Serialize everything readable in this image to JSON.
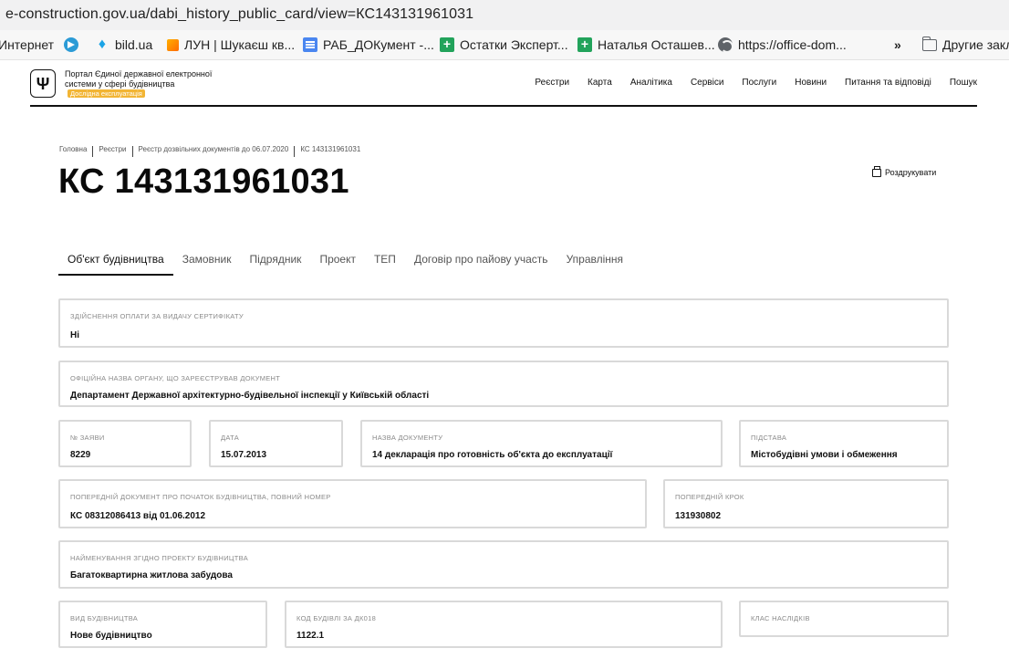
{
  "browser": {
    "url": "e-construction.gov.ua/dabi_history_public_card/view=КС143131961031",
    "bookmarks": [
      {
        "label": "Интернет",
        "icon": "none"
      },
      {
        "label": "",
        "icon": "telegram-icon"
      },
      {
        "label": "bild.ua",
        "icon": "bild-icon"
      },
      {
        "label": "ЛУН | Шукаєш кв...",
        "icon": "lun-icon"
      },
      {
        "label": "РАБ_ДОКумент -...",
        "icon": "docs-icon"
      },
      {
        "label": "Остатки Эксперт...",
        "icon": "sheets-icon"
      },
      {
        "label": "Наталья Осташев...",
        "icon": "sheets-icon"
      },
      {
        "label": "https://office-dom...",
        "icon": "globe-icon"
      }
    ],
    "overflow": "»",
    "other_bookmarks": "Другие закл"
  },
  "header": {
    "portal_name": "Портал Єдиної державної електронної системи у сфері будівництва",
    "beta_badge": "Дослідна експлуатація",
    "nav": [
      "Реєстри",
      "Карта",
      "Аналітика",
      "Сервіси",
      "Послуги",
      "Новини",
      "Питання та відповіді",
      "Пошук"
    ]
  },
  "breadcrumb": [
    "Головна",
    "Реєстри",
    "Реєстр дозвільних документів до 06.07.2020",
    "КС 143131961031"
  ],
  "page": {
    "title": "КС 143131961031",
    "print_label": "Роздрукувати"
  },
  "tabs": [
    "Об'єкт будівництва",
    "Замовник",
    "Підрядник",
    "Проект",
    "ТЕП",
    "Договір про пайову участь",
    "Управління"
  ],
  "fields": {
    "payment": {
      "label": "Здійснення оплати за видачу сертифікату",
      "value": "Ні"
    },
    "authority": {
      "label": "Офіційна назва органу, що зареєстрував документ",
      "value": "Департамент Державної архітектурно-будівельної інспекції у Київській області"
    },
    "app_no": {
      "label": "№ заяви",
      "value": "8229"
    },
    "date": {
      "label": "Дата",
      "value": "15.07.2013"
    },
    "doc_name": {
      "label": "Назва документу",
      "value": "14 декларація про готовність об'єкта до експлуатації"
    },
    "basis": {
      "label": "Підстава",
      "value": "Містобудівні умови і обмеження"
    },
    "prev_doc": {
      "label": "Попередній документ про початок будівництва, повний номер",
      "value": "КС 08312086413 від 01.06.2012"
    },
    "prev_step": {
      "label": "Попередній крок",
      "value": "131930802"
    },
    "project_name": {
      "label": "Найменування згідно проекту будівництва",
      "value": "Багатоквартирна житлова забудова"
    },
    "construction_type": {
      "label": "Вид будівництва",
      "value": "Нове будівництво"
    },
    "building_code": {
      "label": "Код будівлі за ДК018",
      "value": "1122.1"
    },
    "consequence_class": {
      "label": "Клас наслідків",
      "value": ""
    }
  }
}
